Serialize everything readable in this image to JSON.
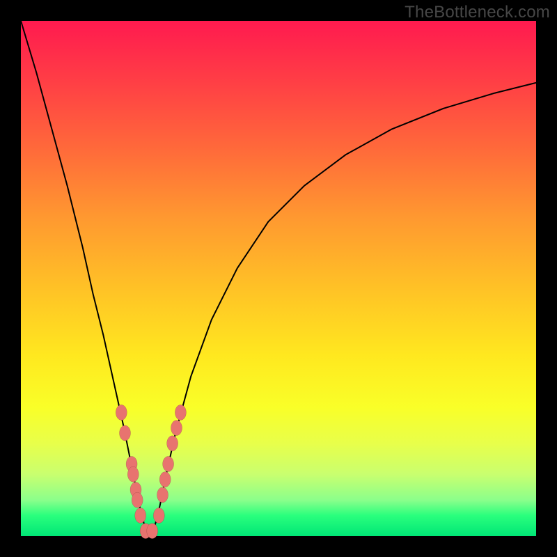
{
  "watermark": "TheBottleneck.com",
  "colors": {
    "frame": "#000000",
    "curve_stroke": "#000000",
    "marker_fill": "#e8736f",
    "gradient_top": "#ff1a4f",
    "gradient_bottom": "#00e676"
  },
  "chart_data": {
    "type": "line",
    "title": "",
    "xlabel": "",
    "ylabel": "",
    "xlim": [
      0,
      100
    ],
    "ylim": [
      0,
      100
    ],
    "curve": {
      "name": "bottleneck-curve",
      "x": [
        0,
        3,
        6,
        9,
        12,
        14,
        16,
        18,
        20,
        21,
        22,
        23,
        24,
        25,
        26,
        27,
        28,
        30,
        33,
        37,
        42,
        48,
        55,
        63,
        72,
        82,
        92,
        100
      ],
      "y": [
        100,
        90,
        79,
        68,
        56,
        47,
        39,
        30,
        21,
        16,
        11,
        6,
        2,
        0,
        2,
        6,
        11,
        20,
        31,
        42,
        52,
        61,
        68,
        74,
        79,
        83,
        86,
        88
      ]
    },
    "markers": {
      "name": "highlighted-points",
      "points": [
        {
          "x": 19.5,
          "y": 24
        },
        {
          "x": 20.2,
          "y": 20
        },
        {
          "x": 21.5,
          "y": 14
        },
        {
          "x": 21.8,
          "y": 12
        },
        {
          "x": 22.3,
          "y": 9
        },
        {
          "x": 22.6,
          "y": 7
        },
        {
          "x": 23.2,
          "y": 4
        },
        {
          "x": 24.2,
          "y": 1
        },
        {
          "x": 25.5,
          "y": 1
        },
        {
          "x": 26.8,
          "y": 4
        },
        {
          "x": 27.5,
          "y": 8
        },
        {
          "x": 28.0,
          "y": 11
        },
        {
          "x": 28.6,
          "y": 14
        },
        {
          "x": 29.4,
          "y": 18
        },
        {
          "x": 30.2,
          "y": 21
        },
        {
          "x": 31.0,
          "y": 24
        }
      ]
    }
  }
}
